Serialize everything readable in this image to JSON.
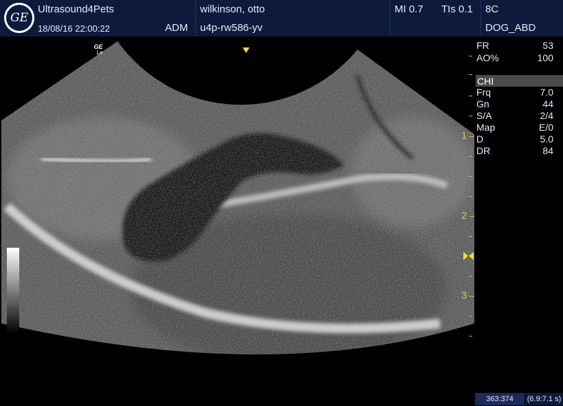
{
  "header": {
    "institution": "Ultrasound4Pets",
    "datetime": "18/08/16 22:00:22",
    "operator": "ADM",
    "patient_name": "wilkinson, otto",
    "patient_id": "u4p-rw586-yv",
    "mi": "MI 0.7",
    "tis": "TIs 0.1",
    "probe": "8C",
    "preset": "DOG_ABD"
  },
  "logo": {
    "text": "GE",
    "icon": "ge-logo-icon"
  },
  "probe_marker": {
    "line1": "GE",
    "line2": "Le"
  },
  "params_top": [
    {
      "key": "FR",
      "value": "53"
    },
    {
      "key": "AO%",
      "value": "100"
    }
  ],
  "mode": "CHI",
  "params": [
    {
      "key": "Frq",
      "value": "7.0"
    },
    {
      "key": "Gn",
      "value": "44"
    },
    {
      "key": "S/A",
      "value": "2/4"
    },
    {
      "key": "Map",
      "value": "E/0"
    },
    {
      "key": "D",
      "value": "5.0"
    },
    {
      "key": "DR",
      "value": "84"
    }
  ],
  "depth_scale": {
    "labels": [
      "1",
      "2",
      "3"
    ]
  },
  "status": {
    "frame": "363:374",
    "time": "(6.9:7.1 s)"
  },
  "colors": {
    "header_bg": "#0d1a3c",
    "scale_yellow": "#d9c25a",
    "focus_marker": "#f0e030"
  }
}
